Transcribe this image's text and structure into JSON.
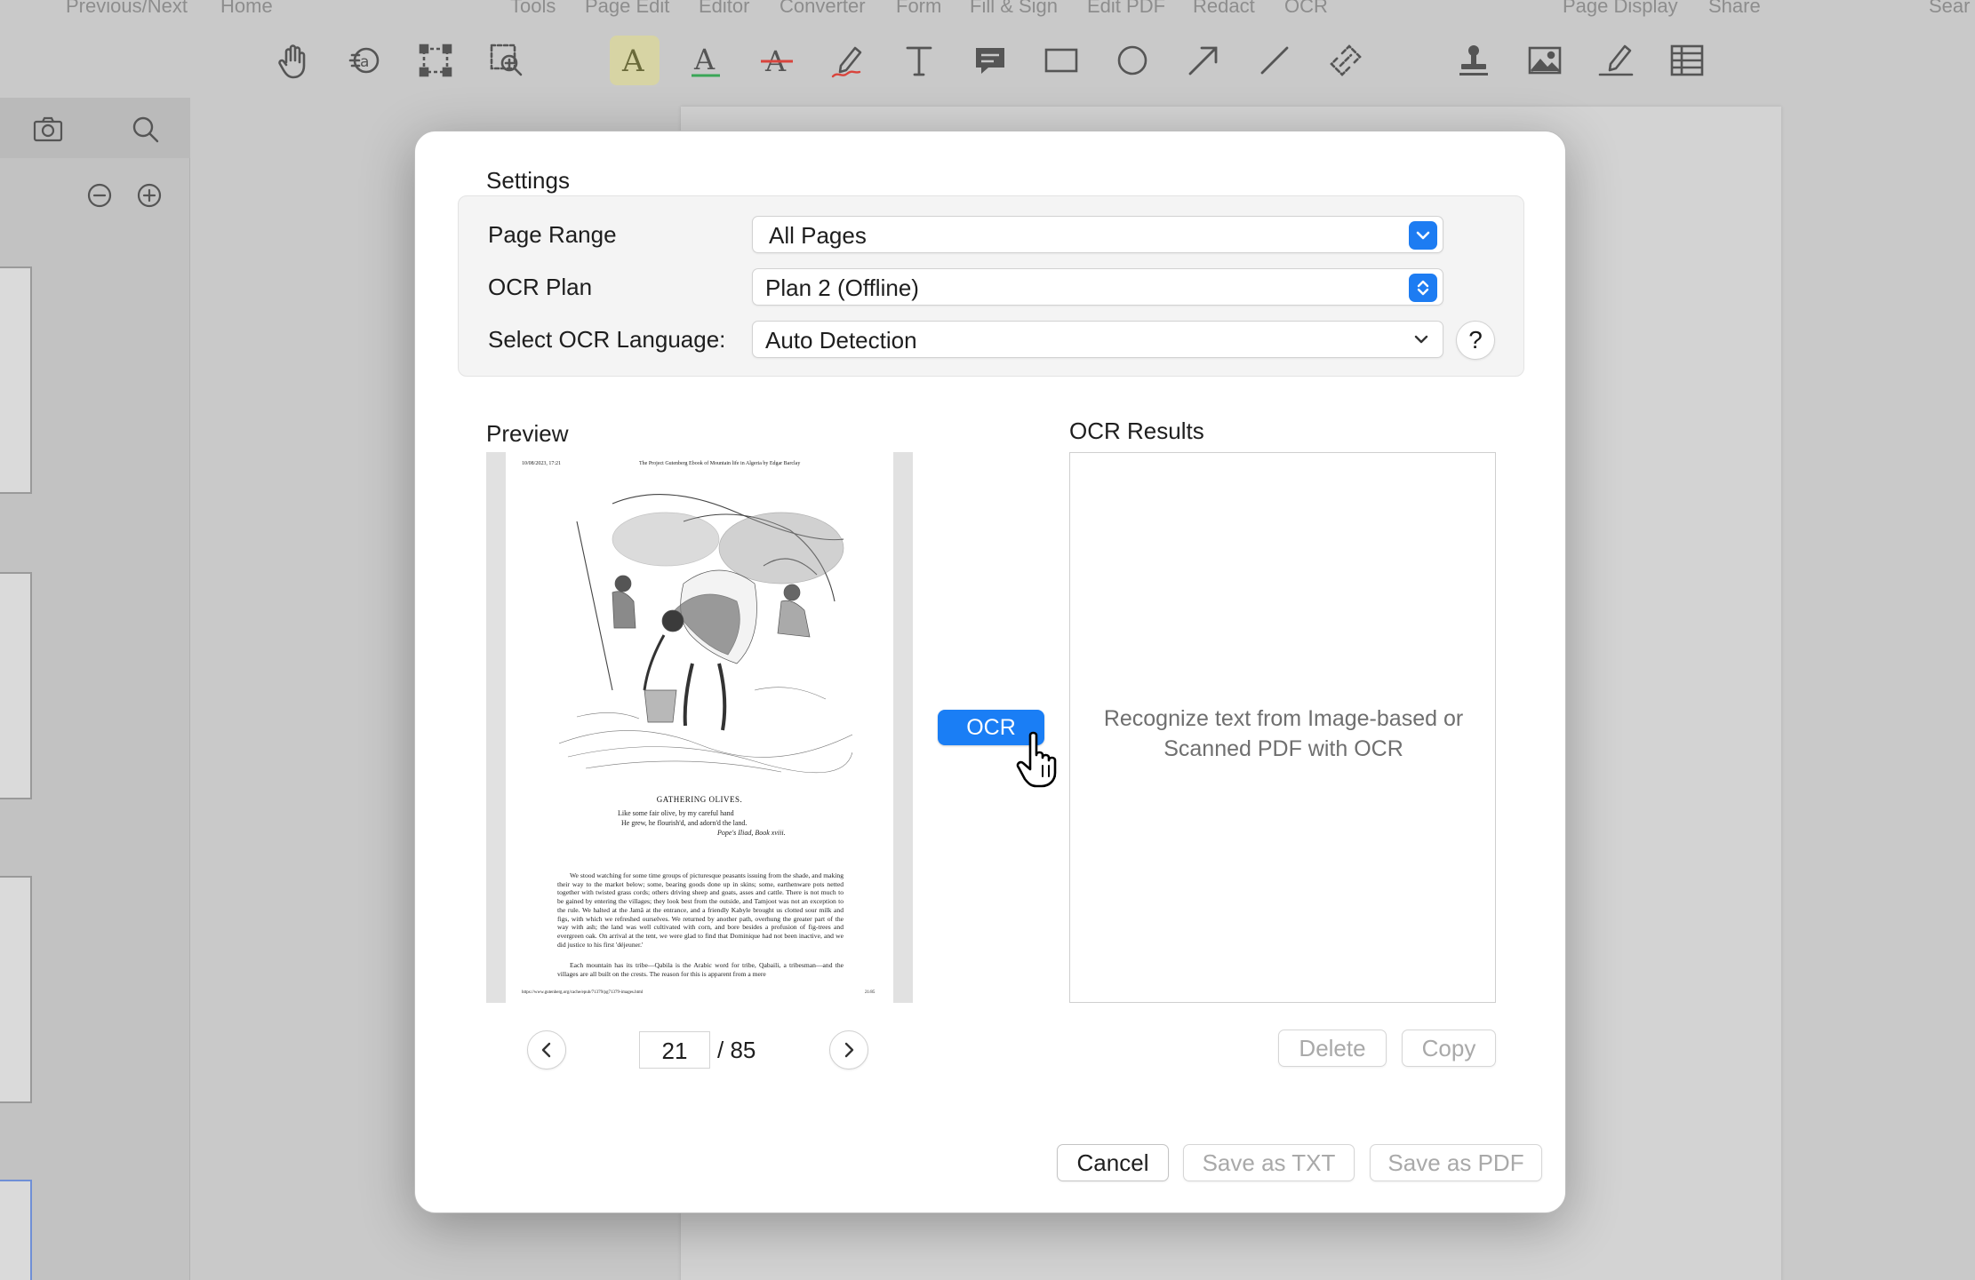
{
  "menu": {
    "items": [
      "Previous/Next",
      "Home",
      "Tools",
      "Page Edit",
      "Editor",
      "Converter",
      "Form",
      "Fill & Sign",
      "Edit PDF",
      "Redact",
      "OCR",
      "Page Display",
      "Share",
      "Sear"
    ]
  },
  "toolbar": {
    "tools": [
      "hand-tool-icon",
      "area-select-icon",
      "marquee-select-icon",
      "zoom-area-icon",
      "highlight-text-icon",
      "underline-text-icon",
      "strikeout-text-icon",
      "freehand-pen-icon",
      "text-box-icon",
      "note-comment-icon",
      "rectangle-icon",
      "ellipse-icon",
      "arrow-icon",
      "line-icon",
      "link-icon",
      "stamp-icon",
      "image-icon",
      "signature-icon",
      "table-icon"
    ],
    "active_tool": "highlight-text-icon",
    "accent_color": "#d7d4a4"
  },
  "sidebar": {
    "icons": [
      "camera-icon",
      "search-icon",
      "zoom-out-icon",
      "zoom-in-icon"
    ]
  },
  "dialog": {
    "settings_title": "Settings",
    "page_range_label": "Page Range",
    "page_range_value": "All Pages",
    "ocr_plan_label": "OCR Plan",
    "ocr_plan_value": "Plan 2 (Offline)",
    "language_label": "Select OCR Language:",
    "language_value": "Auto Detection",
    "help_label": "?",
    "preview_title": "Preview",
    "results_title": "OCR Results",
    "results_placeholder_line1": "Recognize text from Image-based or",
    "results_placeholder_line2": "Scanned PDF with OCR",
    "ocr_button": "OCR",
    "current_page": "21",
    "total_pages": "/ 85",
    "delete_button": "Delete",
    "copy_button": "Copy",
    "cancel_button": "Cancel",
    "save_txt_button": "Save as TXT",
    "save_pdf_button": "Save as PDF",
    "accent_color": "#1a7ef5"
  },
  "preview_page": {
    "header_left": "10/08/2023, 17:21",
    "header_center": "The Project Gutenberg Ebook of Mountain life in Algeria by Edgar Barclay",
    "caption": "GATHERING OLIVES.",
    "poem_line1": "Like some fair olive, by my careful hand",
    "poem_line2": "He grew, he flourish'd, and adorn'd the land.",
    "poem_attribution": "Pope's Iliad, Book xviii.",
    "paragraph1": "We stood watching for some time groups of picturesque peasants issuing from the shade, and making their way to the market below; some, bearing goods done up in skins; some, earthenware pots netted together with twisted grass cords; others driving sheep and goats, asses and cattle. There is not much to be gained by entering the villages; they look best from the outside, and Tamjoot was not an exception to the rule. We halted at the Jamâ at the entrance, and a friendly Kabyle brought us clotted sour milk and figs, with which we refreshed ourselves. We returned by another path, overhung the greater part of the way with ash; the land was well cultivated with corn, and bore besides a profusion of fig-trees and evergreen oak. On arrival at the tent, we were glad to find that Dominique had not been inactive, and we did justice to his first 'déjeuner.'",
    "paragraph2": "Each mountain has its tribe—Qabila is the Arabic word for tribe, Qabaili, a tribesman—and the villages are all built on the crests. The reason for this is apparent from a mere",
    "footer_left": "https://www.gutenberg.org/cache/epub/71379/pg71379-images.html",
    "footer_right": "21/85"
  }
}
